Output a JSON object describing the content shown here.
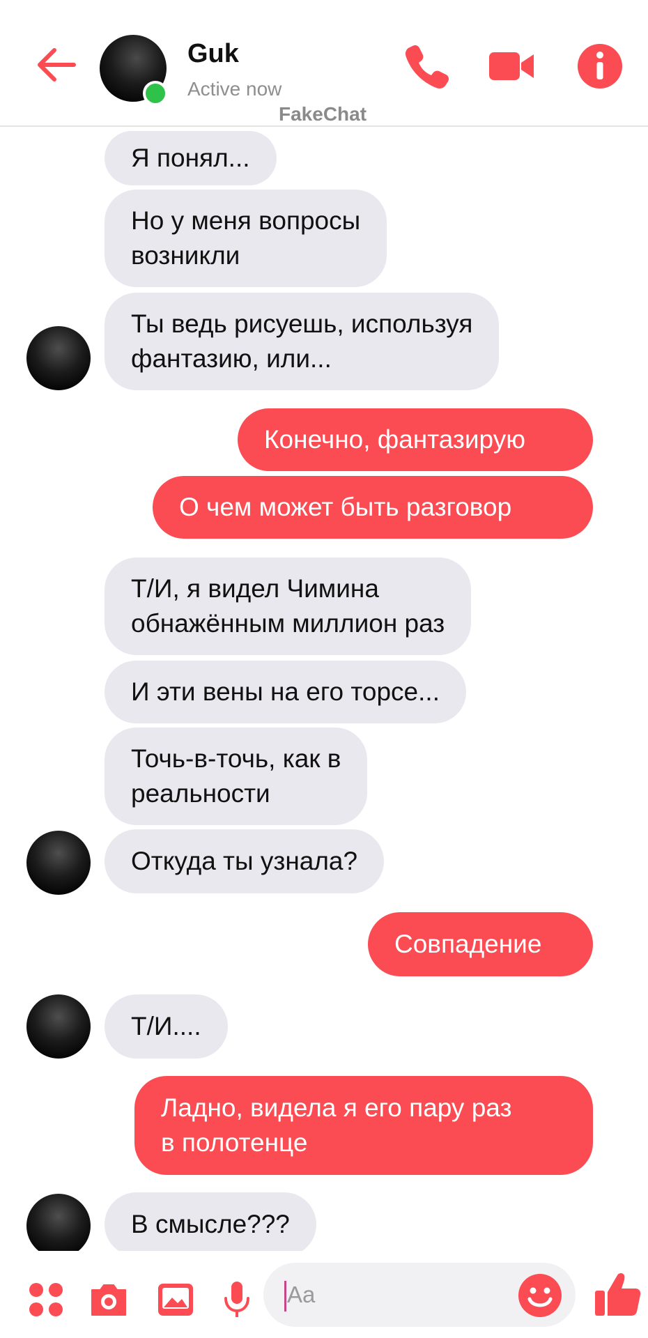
{
  "header": {
    "contact_name": "Guk",
    "status": "Active now",
    "watermark": "FakeChat",
    "back_icon": "arrow-left-icon",
    "call_icon": "phone-icon",
    "video_icon": "video-camera-icon",
    "info_icon": "info-icon",
    "accent_color": "#fa4c52",
    "online_color": "#2ec24a"
  },
  "messages": [
    {
      "side": "in",
      "text": "Я понял..."
    },
    {
      "side": "in",
      "text": "Но у меня вопросы\nвозникли"
    },
    {
      "side": "in",
      "text": "Ты ведь рисуешь, используя\nфантазию, или..."
    },
    {
      "side": "out",
      "text": "Конечно, фантазирую"
    },
    {
      "side": "out",
      "text": "О чем может быть разговор"
    },
    {
      "side": "in",
      "text": "Т/И, я видел Чимина\nобнажённым миллион раз"
    },
    {
      "side": "in",
      "text": "И эти вены на его торсе..."
    },
    {
      "side": "in",
      "text": "Точь-в-точь, как в\nреальности"
    },
    {
      "side": "in",
      "text": "Откуда ты узнала?"
    },
    {
      "side": "out",
      "text": "Совпадение"
    },
    {
      "side": "in",
      "text": "Т/И...."
    },
    {
      "side": "out",
      "text": "Ладно, видела я его пару раз\nв полотенце"
    },
    {
      "side": "in",
      "text": "В смысле???"
    }
  ],
  "composer": {
    "placeholder": "Aa",
    "menu_icon": "four-dots-icon",
    "camera_icon": "camera-icon",
    "gallery_icon": "image-icon",
    "mic_icon": "microphone-icon",
    "emoji_icon": "smiley-icon",
    "like_icon": "thumbs-up-icon"
  },
  "colors": {
    "incoming_bubble": "#e9e8ee",
    "outgoing_bubble": "#fa4c52"
  }
}
